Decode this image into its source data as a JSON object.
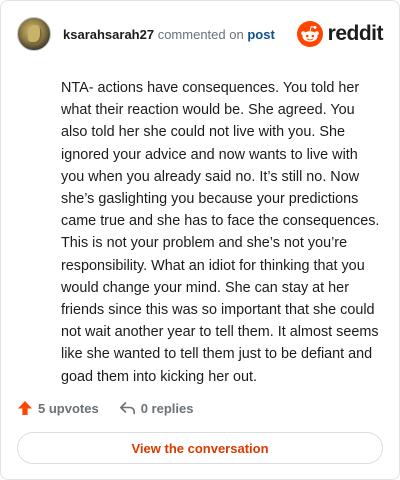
{
  "header": {
    "username": "ksarahsarah27",
    "action_text": "commented on",
    "post_link": "post",
    "brand_name": "reddit"
  },
  "comment": {
    "text": "NTA- actions have consequences. You told her what their reaction would be. She agreed. You also told her she could not live with you. She ignored your advice and now wants to live with you when you already said no. It’s still no. Now she’s gaslighting you because your predictions came true and she has to face the consequences. This is not your problem and she’s not you’re responsibility. What an idiot for thinking that you would change your mind. She can stay at her friends since this was so important that she could not wait another year to tell them. It almost seems like she wanted to tell them just to be defiant and goad them into kicking her out."
  },
  "footer": {
    "upvotes": "5 upvotes",
    "replies": "0 replies"
  },
  "cta": {
    "label": "View the conversation"
  },
  "icons": {
    "avatar": "user-avatar",
    "brand": "reddit-logo-icon",
    "upvote": "upvote-arrow-icon",
    "reply": "reply-arrow-icon"
  },
  "colors": {
    "brand_orange": "#ff4500",
    "link_blue": "#0f4f8b",
    "cta_text": "#d93a00",
    "muted_text": "#6a7177"
  }
}
